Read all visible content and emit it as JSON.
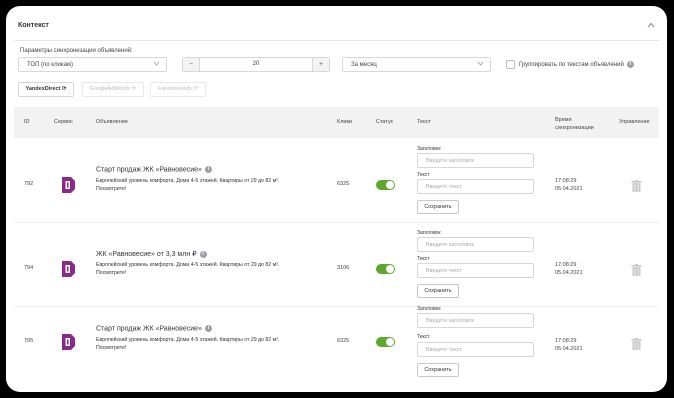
{
  "panel": {
    "title": "Контекст"
  },
  "filters": {
    "sync_label": "Параметры синхронизации объявлений:",
    "sort_value": "ТОП (по кликам)",
    "count_value": "20",
    "period_value": "За месяц",
    "group_label": "Группировать по текстам объявлений"
  },
  "services": [
    "YandexDirect",
    "GoogleAdWords",
    "FacebookAds"
  ],
  "columns": {
    "id": "ID",
    "service": "Сервис",
    "ad": "Объявление",
    "clicks": "Клики",
    "status": "Статус",
    "text": "Текст",
    "sync_time": "Время синхронизации",
    "manage": "Управление"
  },
  "form": {
    "title_label": "Заголовок",
    "title_placeholder": "Введите заголовок",
    "text_label": "Текст",
    "text_placeholder": "Введите текст",
    "save_label": "Сохранить"
  },
  "rows": [
    {
      "id": "792",
      "title": "Старт продаж ЖК «Равновесие»",
      "desc1": "Европейский уровень комфорта. Дома 4-5 этажей. Квартиры от 29 до 82 м².",
      "desc2": "Посмотрите!",
      "clicks": "6325",
      "status_on": true,
      "sync_time": "17:08:29",
      "sync_date": "05.04.2021"
    },
    {
      "id": "794",
      "title": "ЖК «Равновесие» от 3,3 млн ₽",
      "desc1": "Европейский уровень комфорта. Дома 4-5 этажей. Квартиры от 29 до 82 м².",
      "desc2": "Посмотрите!",
      "clicks": "3106",
      "status_on": true,
      "sync_time": "17:08:29",
      "sync_date": "05.04.2021"
    },
    {
      "id": "795",
      "title": "Старт продаж ЖК «Равновесие»",
      "desc1": "Европейский уровень комфорта. Дома 4-5 этажей. Квартиры от 29 до 82 м².",
      "desc2": "Посмотрите!",
      "clicks": "6325",
      "status_on": true,
      "sync_time": "17:08:29",
      "sync_date": "05.04.2021"
    }
  ],
  "colors": {
    "toggle_on": "#5fa82d",
    "yandex_logo": "#8a2a88",
    "header_bg": "#f2f2f2"
  }
}
